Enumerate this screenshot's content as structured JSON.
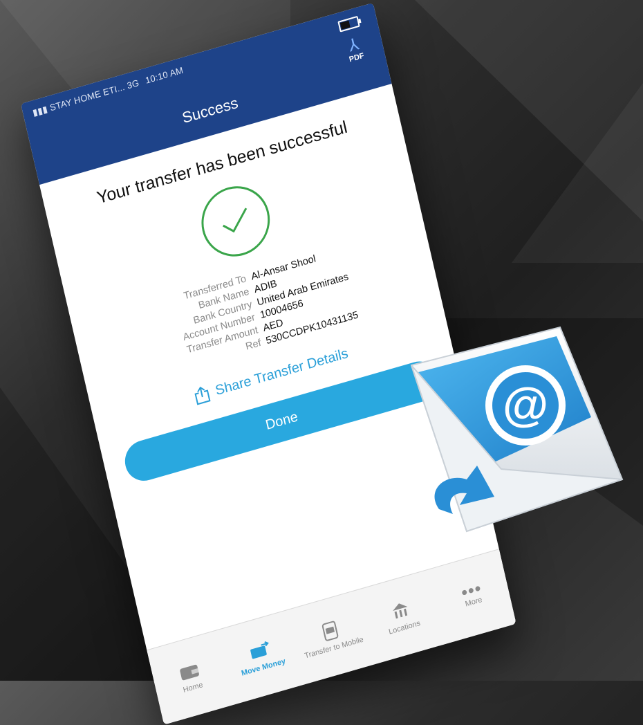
{
  "status_bar": {
    "carrier": "STAY HOME ETI...",
    "network": "3G",
    "time": "10:10 AM"
  },
  "header": {
    "title": "Success",
    "pdf_label": "PDF"
  },
  "success": {
    "headline": "Your transfer has been successful",
    "details": [
      {
        "label": "Transferred To",
        "value": "Al-Ansar Shool"
      },
      {
        "label": "Bank Name",
        "value": "ADIB"
      },
      {
        "label": "Bank Country",
        "value": "United Arab Emirates"
      },
      {
        "label": "Account Number",
        "value": "10004656"
      },
      {
        "label": "Transfer Amount",
        "value": "AED"
      },
      {
        "label": "Ref",
        "value": "530CCDPK10431135"
      }
    ]
  },
  "actions": {
    "share_label": "Share Transfer Details",
    "done_label": "Done"
  },
  "tabbar": [
    {
      "label": "Home",
      "icon": "wallet-icon"
    },
    {
      "label": "Move Money",
      "icon": "money-transfer-icon",
      "active": true
    },
    {
      "label": "Transfer to Mobile",
      "icon": "mobile-money-icon"
    },
    {
      "label": "Locations",
      "icon": "location-bank-icon"
    },
    {
      "label": "More",
      "icon": "more-dots-icon"
    }
  ],
  "colors": {
    "header": "#1e4389",
    "accent": "#29a8df",
    "success": "#3aa54a"
  }
}
